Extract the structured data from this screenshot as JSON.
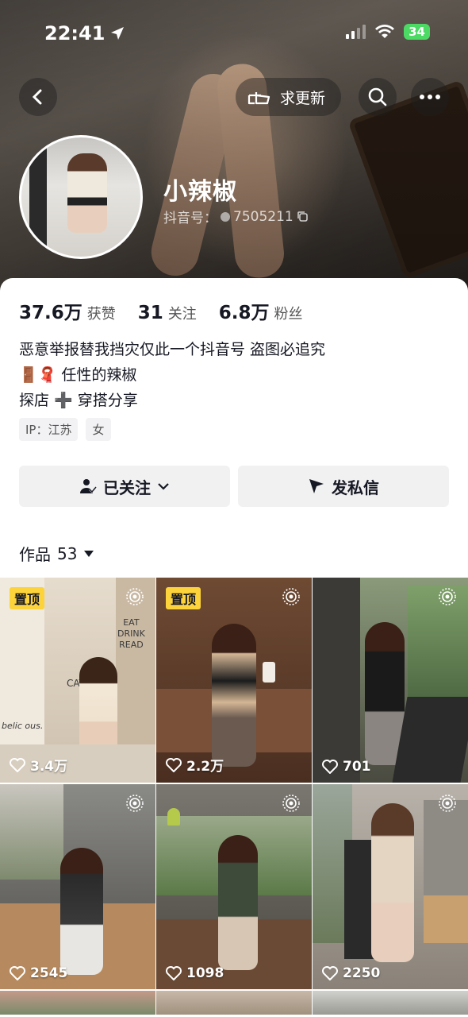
{
  "status_bar": {
    "time": "22:41",
    "battery": "34"
  },
  "header": {
    "update_button": "求更新"
  },
  "profile": {
    "name": "小辣椒",
    "douyin_id_prefix": "抖音号：",
    "douyin_id": "7505211"
  },
  "stats": [
    {
      "value": "37.6万",
      "label": "获赞"
    },
    {
      "value": "31",
      "label": "关注"
    },
    {
      "value": "6.8万",
      "label": "粉丝"
    }
  ],
  "bio": {
    "line1": "恶意举报替我挡灾仅此一个抖音号 盗图必追究",
    "line2_emoji": "🚪🧣",
    "line2": "任性的辣椒",
    "line3a": "探店",
    "line3_plus": "➕",
    "line3b": "穿搭分享"
  },
  "tags": [
    "IP：江苏",
    "女"
  ],
  "buttons": {
    "follow": "已关注",
    "message": "发私信"
  },
  "works": {
    "label": "作品",
    "count": "53"
  },
  "videos": [
    {
      "pinned": "置顶",
      "likes": "3.4万",
      "bg": "#d9cdbd"
    },
    {
      "pinned": "置顶",
      "likes": "2.2万",
      "bg": "#5a3a28"
    },
    {
      "pinned": "",
      "likes": "701",
      "bg": "#6b7a5c"
    },
    {
      "pinned": "",
      "likes": "2545",
      "bg": "#8a8a86"
    },
    {
      "pinned": "",
      "likes": "1098",
      "bg": "#6e6e68"
    },
    {
      "pinned": "",
      "likes": "2250",
      "bg": "#a09890"
    }
  ],
  "cell_text": {
    "cell1_sign": "EAT\nDRINK\nREAD",
    "cell1_cate": "CATE",
    "cell1_wall": "belic ous."
  }
}
